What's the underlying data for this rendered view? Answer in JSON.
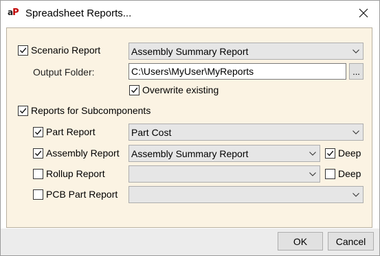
{
  "window": {
    "title": "Spreadsheet Reports...",
    "app_icon": "aP",
    "close_icon": "close-icon"
  },
  "scenario": {
    "label": "Scenario Report",
    "checked": true,
    "report_value": "Assembly Summary Report"
  },
  "output": {
    "label": "Output Folder:",
    "value": "C:\\Users\\MyUser\\MyReports",
    "browse_label": "...",
    "overwrite_label": "Overwrite existing",
    "overwrite_checked": true
  },
  "subcomponents": {
    "label": "Reports for Subcomponents",
    "checked": true,
    "part": {
      "label": "Part Report",
      "checked": true,
      "value": "Part Cost"
    },
    "assembly": {
      "label": "Assembly Report",
      "checked": true,
      "value": "Assembly Summary Report",
      "deep_label": "Deep",
      "deep_checked": true
    },
    "rollup": {
      "label": "Rollup Report",
      "checked": false,
      "value": "",
      "deep_label": "Deep",
      "deep_checked": false
    },
    "pcb": {
      "label": "PCB Part Report",
      "checked": false,
      "value": ""
    }
  },
  "buttons": {
    "ok": "OK",
    "cancel": "Cancel"
  },
  "colors": {
    "panel_bg": "#fbf3e3",
    "bottom_bar": "#ececec",
    "accent_red": "#c00000"
  }
}
